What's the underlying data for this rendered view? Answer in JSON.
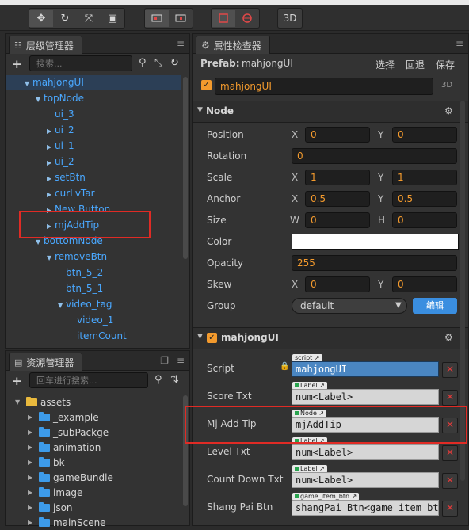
{
  "toolbar": {
    "group1": [
      "move-icon",
      "rotate-icon",
      "scale-icon",
      "rect-icon"
    ],
    "group2": [
      "local-icon",
      "pivot-icon"
    ],
    "group3": [
      "frame-icon",
      "globe-icon"
    ],
    "mode_3d": "3D"
  },
  "hierarchy": {
    "title": "层级管理器",
    "search_placeholder": "搜索...",
    "items": [
      {
        "label": "mahjongUI",
        "depth": 0,
        "expanded": true,
        "has_children": true
      },
      {
        "label": "topNode",
        "depth": 1,
        "expanded": true,
        "has_children": true
      },
      {
        "label": "ui_3",
        "depth": 2,
        "has_children": false
      },
      {
        "label": "ui_2",
        "depth": 2,
        "has_children": true
      },
      {
        "label": "ui_1",
        "depth": 2,
        "has_children": true
      },
      {
        "label": "ui_2",
        "depth": 2,
        "has_children": true
      },
      {
        "label": "setBtn",
        "depth": 2,
        "has_children": true
      },
      {
        "label": "curLvTar",
        "depth": 2,
        "has_children": true
      },
      {
        "label": "New Button",
        "depth": 2,
        "has_children": true
      },
      {
        "label": "mjAddTip",
        "depth": 2,
        "has_children": true
      },
      {
        "label": "bottomNode",
        "depth": 1,
        "expanded": true,
        "has_children": true
      },
      {
        "label": "removeBtn",
        "depth": 2,
        "expanded": true,
        "has_children": true
      },
      {
        "label": "btn_5_2",
        "depth": 3,
        "has_children": false
      },
      {
        "label": "btn_5_1",
        "depth": 3,
        "has_children": false
      },
      {
        "label": "video_tag",
        "depth": 3,
        "expanded": true,
        "has_children": true
      },
      {
        "label": "video_1",
        "depth": 4,
        "has_children": false
      },
      {
        "label": "itemCount",
        "depth": 4,
        "has_children": false
      }
    ]
  },
  "assets": {
    "title": "资源管理器",
    "search_placeholder": "回车进行搜索...",
    "items": [
      {
        "label": "assets",
        "depth": 0,
        "root": true
      },
      {
        "label": "_example",
        "depth": 1
      },
      {
        "label": "_subPackge",
        "depth": 1
      },
      {
        "label": "animation",
        "depth": 1
      },
      {
        "label": "bk",
        "depth": 1
      },
      {
        "label": "gameBundle",
        "depth": 1
      },
      {
        "label": "image",
        "depth": 1
      },
      {
        "label": "json",
        "depth": 1
      },
      {
        "label": "mainScene",
        "depth": 1
      }
    ]
  },
  "inspector": {
    "title": "属性检查器",
    "prefab_label": "Prefab:",
    "prefab_name": "mahjongUI",
    "btn_select": "选择",
    "btn_revert": "回退",
    "btn_save": "保存",
    "node_name": "mahjongUI",
    "badge_3d": "3D",
    "node_section": "Node",
    "position": {
      "label": "Position",
      "x_axis": "X",
      "x": "0",
      "y_axis": "Y",
      "y": "0"
    },
    "rotation": {
      "label": "Rotation",
      "value": "0"
    },
    "scale": {
      "label": "Scale",
      "x_axis": "X",
      "x": "1",
      "y_axis": "Y",
      "y": "1"
    },
    "anchor": {
      "label": "Anchor",
      "x_axis": "X",
      "x": "0.5",
      "y_axis": "Y",
      "y": "0.5"
    },
    "size": {
      "label": "Size",
      "w_axis": "W",
      "w": "0",
      "h_axis": "H",
      "h": "0"
    },
    "color": {
      "label": "Color",
      "value": "#FFFFFF"
    },
    "opacity": {
      "label": "Opacity",
      "value": "255"
    },
    "skew": {
      "label": "Skew",
      "x_axis": "X",
      "x": "0",
      "y_axis": "Y",
      "y": "0"
    },
    "group": {
      "label": "Group",
      "value": "default",
      "edit": "编辑"
    },
    "component_section": "mahjongUI",
    "script": {
      "label": "Script",
      "tag": "script",
      "value": "mahjongUI"
    },
    "score_txt": {
      "label": "Score Txt",
      "tag": "Label",
      "value": "num<Label>"
    },
    "mj_add_tip": {
      "label": "Mj Add Tip",
      "tag": "Node",
      "value": "mjAddTip"
    },
    "level_txt": {
      "label": "Level Txt",
      "tag": "Label",
      "value": "num<Label>"
    },
    "count_down_txt": {
      "label": "Count Down Txt",
      "tag": "Label",
      "value": "num<Label>"
    },
    "shang_pai_btn": {
      "label": "Shang Pai Btn",
      "tag": "game_item_btn",
      "value": "shangPai_Btn<game_item_btn>"
    }
  }
}
